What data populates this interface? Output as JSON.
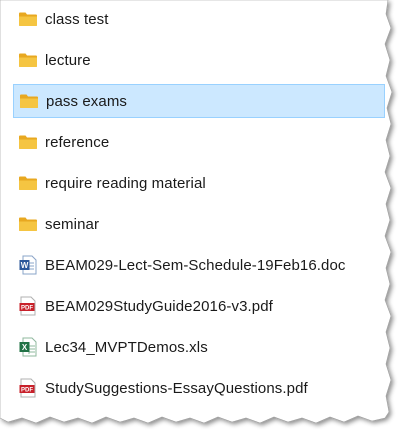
{
  "explorer": {
    "items": [
      {
        "name": "class test",
        "type": "folder",
        "icon": "folder-icon",
        "selected": false
      },
      {
        "name": "lecture",
        "type": "folder",
        "icon": "folder-icon",
        "selected": false
      },
      {
        "name": "pass exams",
        "type": "folder",
        "icon": "folder-icon",
        "selected": true
      },
      {
        "name": "reference",
        "type": "folder",
        "icon": "folder-icon",
        "selected": false
      },
      {
        "name": "require reading material",
        "type": "folder",
        "icon": "folder-icon",
        "selected": false
      },
      {
        "name": "seminar",
        "type": "folder",
        "icon": "folder-icon",
        "selected": false
      },
      {
        "name": "BEAM029-Lect-Sem-Schedule-19Feb16.doc",
        "type": "word",
        "icon": "word-document-icon",
        "selected": false
      },
      {
        "name": "BEAM029StudyGuide2016-v3.pdf",
        "type": "pdf",
        "icon": "pdf-file-icon",
        "icon_text": "PDF",
        "selected": false
      },
      {
        "name": "Lec34_MVPTDemos.xls",
        "type": "excel",
        "icon": "excel-spreadsheet-icon",
        "selected": false
      },
      {
        "name": "StudySuggestions-EssayQuestions.pdf",
        "type": "pdf",
        "icon": "pdf-file-icon",
        "icon_text": "PDF",
        "selected": false
      }
    ]
  },
  "colors": {
    "selection": "#cce8ff",
    "selection_border": "#99d1ff",
    "folder": "#f5c542",
    "pdf": "#c8202a",
    "word": "#2b579a",
    "excel": "#217346"
  }
}
